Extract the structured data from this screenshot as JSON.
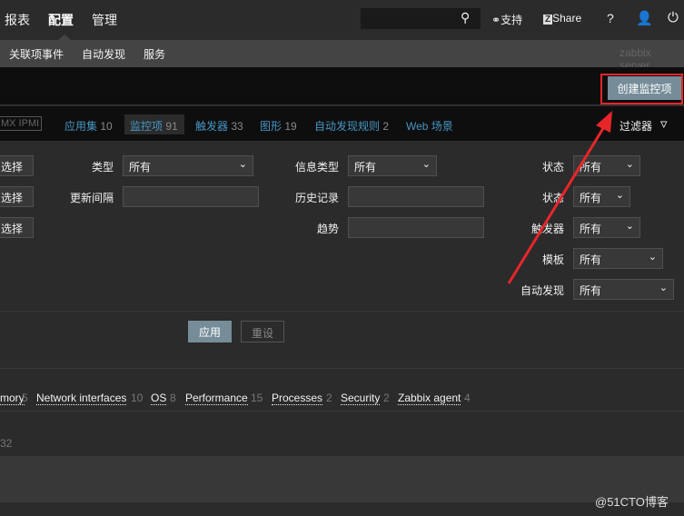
{
  "topnav": {
    "items": [
      "报表",
      "配置",
      "管理"
    ],
    "active": "配置",
    "support": "支持",
    "share": "Share",
    "help": "?"
  },
  "subnav": {
    "items": [
      "关联项事件",
      "自动发现",
      "服务"
    ],
    "server": "zabbix server"
  },
  "header": {
    "create_button": "创建监控项"
  },
  "tabs": {
    "partial": "MX IPMI",
    "items": [
      {
        "label": "应用集",
        "count": "10"
      },
      {
        "label": "监控项",
        "count": "91"
      },
      {
        "label": "触发器",
        "count": "33"
      },
      {
        "label": "图形",
        "count": "19"
      },
      {
        "label": "自动发现规则",
        "count": "2"
      },
      {
        "label": "Web 场景",
        "count": ""
      }
    ],
    "filter": "过滤器"
  },
  "filter": {
    "pick": "选择",
    "type_label": "类型",
    "type_value": "所有",
    "update_label": "更新间隔",
    "info_label": "信息类型",
    "info_value": "所有",
    "history_label": "历史记录",
    "trend_label": "趋势",
    "state_label": "状态",
    "state_value": "所有",
    "status_label": "状态",
    "status_value": "所有",
    "triggers_label": "触发器",
    "triggers_value": "所有",
    "template_label": "模板",
    "template_value": "所有",
    "discovery_label": "自动发现",
    "discovery_value": "所有",
    "apply": "应用",
    "reset": "重设"
  },
  "tags": [
    {
      "label": "mory",
      "count": "5"
    },
    {
      "label": "Network interfaces",
      "count": "10"
    },
    {
      "label": "OS",
      "count": "8"
    },
    {
      "label": "Performance",
      "count": "15"
    },
    {
      "label": "Processes",
      "count": "2"
    },
    {
      "label": "Security",
      "count": "2"
    },
    {
      "label": "Zabbix agent",
      "count": "4"
    }
  ],
  "partial_count": "32",
  "watermark": "@51CTO博客",
  "colors": {
    "accent": "#768d99",
    "link": "#4796c4",
    "highlight": "#e8262a"
  }
}
